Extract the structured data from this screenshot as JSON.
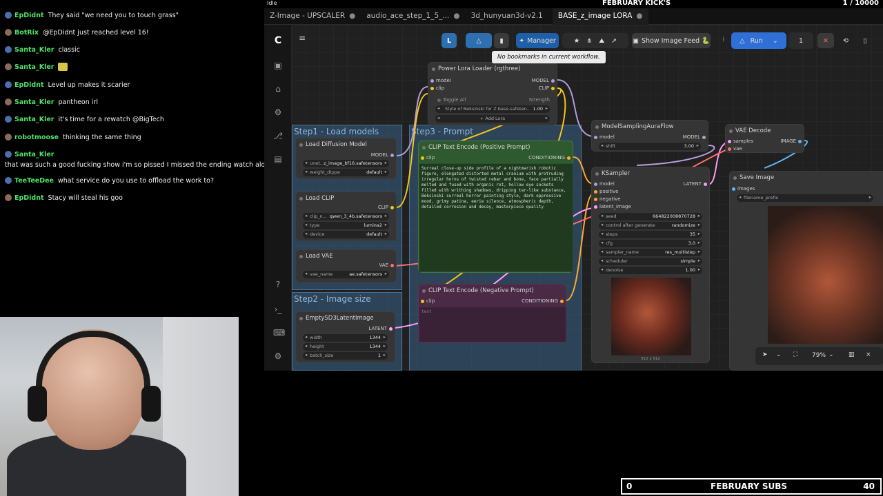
{
  "overlay": {
    "top_left_status": "Idle",
    "top_title": "FEBRUARY KICK'S",
    "top_counter": "1 / 10000",
    "subs_left": "0",
    "subs_title": "FEBRUARY SUBS",
    "subs_right": "40"
  },
  "chat": [
    {
      "name": "EpDidnt",
      "color": "#4ee36a",
      "message": "They said \"we need you to touch grass\""
    },
    {
      "name": "BotRix",
      "color": "#4ee36a",
      "message": "@EpDidnt just reached level 16!"
    },
    {
      "name": "Santa_Kler",
      "color": "#4ee36a",
      "message": "classic"
    },
    {
      "name": "Santa_Kler",
      "color": "#4ee36a",
      "message": ""
    },
    {
      "name": "EpDidnt",
      "color": "#4ee36a",
      "message": "Level up makes it scarier"
    },
    {
      "name": "Santa_Kler",
      "color": "#4ee36a",
      "message": "pantheon irl"
    },
    {
      "name": "Santa_Kler",
      "color": "#4ee36a",
      "message": "it's time for a rewatch @BigTech"
    },
    {
      "name": "robotmoose",
      "color": "#4ee36a",
      "message": "thinking the same thing"
    },
    {
      "name": "Santa_Kler",
      "color": "#4ee36a",
      "message": ""
    },
    {
      "name": "",
      "color": "#4ee36a",
      "message": "that was such a good fucking show i'm so pissed I missed the ending watch along"
    },
    {
      "name": "TeeTeeDee",
      "color": "#4ee36a",
      "message": "what service do you use to offload the work to?"
    },
    {
      "name": "EpDidnt",
      "color": "#4ee36a",
      "message": "Stacy will steal his goo"
    }
  ],
  "tabs": [
    {
      "label": "Z-Image - UPSCALER",
      "dot": "●"
    },
    {
      "label": "audio_ace_step_1_5_...",
      "dot": "●"
    },
    {
      "label": "3d_hunyuan3d-v2.1",
      "dot": ""
    },
    {
      "label": "BASE_z_image LORA",
      "dot": "●"
    }
  ],
  "toolbar": {
    "manager": "Manager",
    "show_image_feed": "Show Image Feed 🐍",
    "run": "Run",
    "queue_count": "1",
    "tooltip": "No bookmarks in current workflow.",
    "zoom": "79%"
  },
  "groups": {
    "load_models": "Step1 - Load models",
    "prompt": "Step3 - Prompt",
    "image_size": "Step2 - Image size"
  },
  "nodes": {
    "power_lora": {
      "title": "Power Lora Loader (rgthree)",
      "in_model": "model",
      "in_clip": "clip",
      "out_model": "MODEL",
      "out_clip": "CLIP",
      "toggle_all": "Toggle All",
      "strength_label": "Strength",
      "lora_name": "Style of Beksinski for Z base.safeten...",
      "lora_strength": "1.00",
      "add_lora": "+ Add Lora"
    },
    "load_diffusion": {
      "title": "Load Diffusion Model",
      "out": "MODEL",
      "unet_label": "unet...",
      "unet_value": "z_image_bf16.safetensors",
      "dtype_label": "weight_dtype",
      "dtype_value": "default"
    },
    "load_clip": {
      "title": "Load CLIP",
      "out": "CLIP",
      "clip_label": "clip_n...",
      "clip_value": "qwen_3_4b.safetensors",
      "type_label": "type",
      "type_value": "lumina2",
      "device_label": "device",
      "device_value": "default"
    },
    "load_vae": {
      "title": "Load VAE",
      "out": "VAE",
      "vae_label": "vae_name",
      "vae_value": "ae.safetensors"
    },
    "clip_pos": {
      "title": "CLIP Text Encode (Positive Prompt)",
      "in": "clip",
      "out": "CONDITIONING",
      "text": "Surreal close-up side profile of a nightmarish robotic figure, elongated distorted metal cranium with protruding irregular horns of twisted rebar and bone, face partially melted and fused with organic rot, hollow eye sockets filled with writhing shadows, dripping tar-like substance, Beksinski surreal horror painting style, dark oppressive mood, grimy patina, eerie silence, atmospheric depth, detailed corrosion and decay, masterpiece quality"
    },
    "clip_neg": {
      "title": "CLIP Text Encode (Negative Prompt)",
      "in": "clip",
      "out": "CONDITIONING",
      "placeholder": "text"
    },
    "empty_latent": {
      "title": "EmptySD3LatentImage",
      "out": "LATENT",
      "width_label": "width",
      "width_value": "1344",
      "height_label": "height",
      "height_value": "1344",
      "batch_label": "batch_size",
      "batch_value": "1"
    },
    "model_sampling": {
      "title": "ModelSamplingAuraFlow",
      "in": "model",
      "out": "MODEL",
      "shift_label": "shift",
      "shift_value": "3.00"
    },
    "ksampler": {
      "title": "KSampler",
      "in_model": "model",
      "in_positive": "positive",
      "in_negative": "negative",
      "in_latent": "latent_image",
      "out": "LATENT",
      "seed_label": "seed",
      "seed_value": "664822008870728",
      "cag_label": "control after generate",
      "cag_value": "randomize",
      "steps_label": "steps",
      "steps_value": "35",
      "cfg_label": "cfg",
      "cfg_value": "3.0",
      "sampler_label": "sampler_name",
      "sampler_value": "res_multistep",
      "scheduler_label": "scheduler",
      "scheduler_value": "simple",
      "denoise_label": "denoise",
      "denoise_value": "1.00",
      "preview_size": "512 x 512"
    },
    "vae_decode": {
      "title": "VAE Decode",
      "in_samples": "samples",
      "in_vae": "vae",
      "out": "IMAGE"
    },
    "save_image": {
      "title": "Save Image",
      "in": "images",
      "prefix_label": "filename_prefix"
    }
  },
  "colors": {
    "clip_wire": "#f5c518",
    "model_wire": "#b39ddb",
    "vae_wire": "#ff6e6e",
    "latent_wire": "#ff9cf9",
    "image_wire": "#64b5f6",
    "conditioning_wire": "#ffa931",
    "run_button": "#2f6fd6",
    "manager_button": "#1f5fa8"
  }
}
